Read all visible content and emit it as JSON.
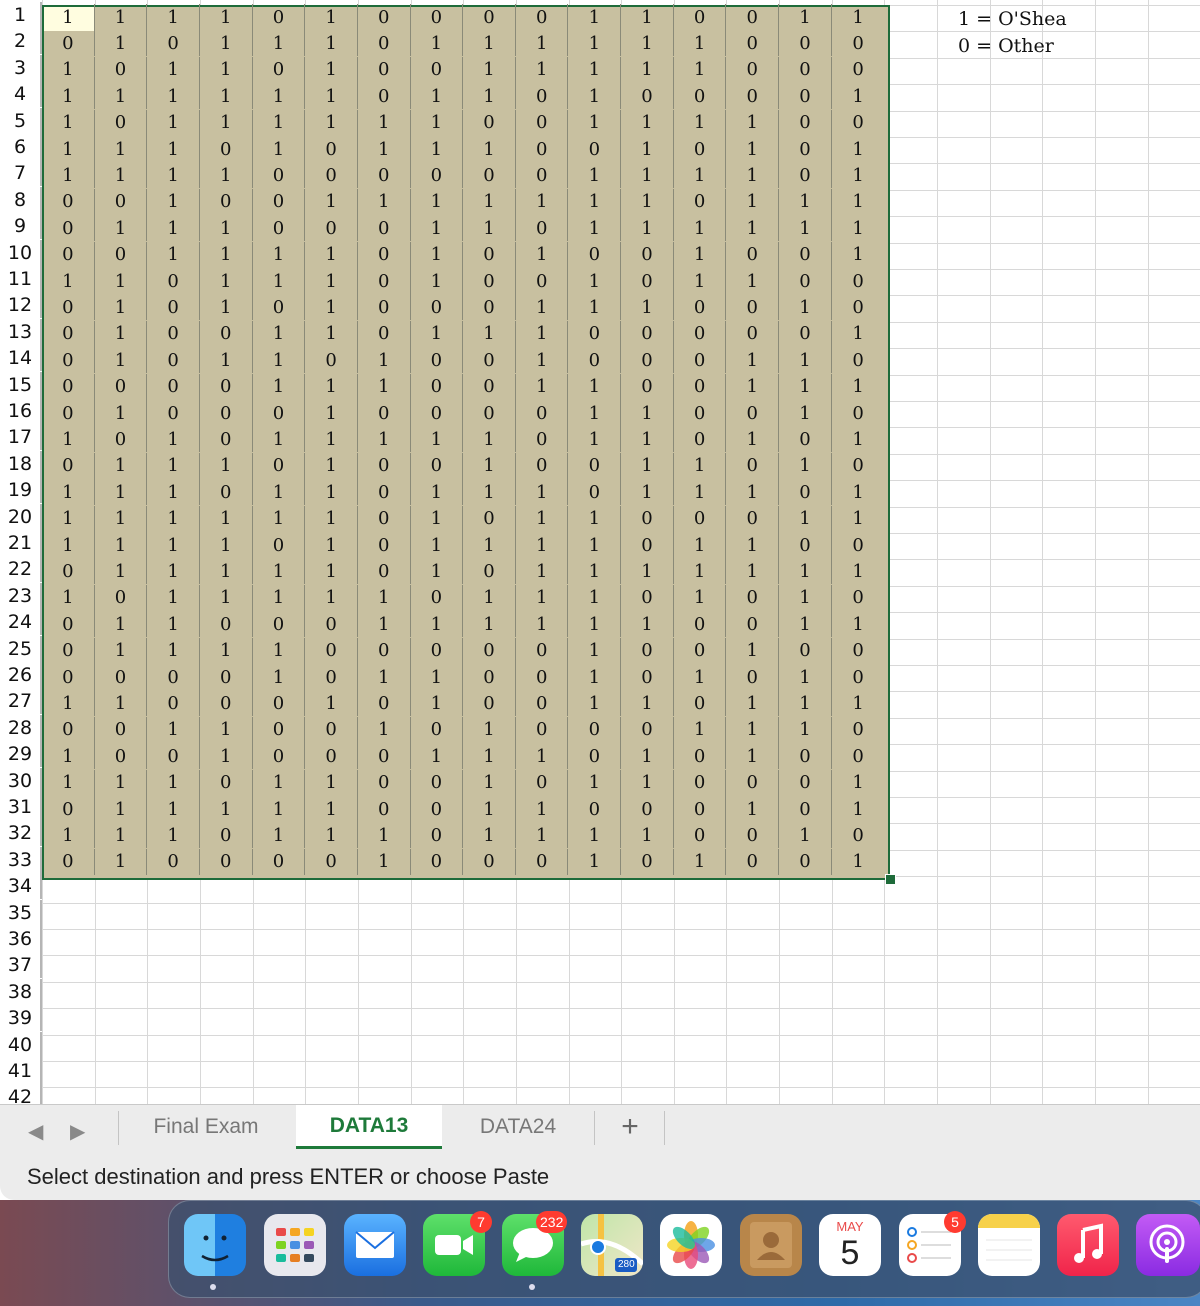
{
  "sheet": {
    "row_numbers": [
      "1",
      "2",
      "3",
      "4",
      "5",
      "6",
      "7",
      "8",
      "9",
      "10",
      "11",
      "12",
      "13",
      "14",
      "15",
      "16",
      "17",
      "18",
      "19",
      "20",
      "21",
      "22",
      "23",
      "24",
      "25",
      "26",
      "27",
      "28",
      "29",
      "30",
      "31",
      "32",
      "33",
      "34",
      "35",
      "36",
      "37",
      "38",
      "39",
      "40",
      "41",
      "42"
    ],
    "rows": [
      [
        "1",
        "1",
        "1",
        "1",
        "0",
        "1",
        "0",
        "0",
        "0",
        "0",
        "1",
        "1",
        "0",
        "0",
        "1",
        "1"
      ],
      [
        "0",
        "1",
        "0",
        "1",
        "1",
        "1",
        "0",
        "1",
        "1",
        "1",
        "1",
        "1",
        "1",
        "0",
        "0",
        "0"
      ],
      [
        "1",
        "0",
        "1",
        "1",
        "0",
        "1",
        "0",
        "0",
        "1",
        "1",
        "1",
        "1",
        "1",
        "0",
        "0",
        "0"
      ],
      [
        "1",
        "1",
        "1",
        "1",
        "1",
        "1",
        "0",
        "1",
        "1",
        "0",
        "1",
        "0",
        "0",
        "0",
        "0",
        "1"
      ],
      [
        "1",
        "0",
        "1",
        "1",
        "1",
        "1",
        "1",
        "1",
        "0",
        "0",
        "1",
        "1",
        "1",
        "1",
        "0",
        "0"
      ],
      [
        "1",
        "1",
        "1",
        "0",
        "1",
        "0",
        "1",
        "1",
        "1",
        "0",
        "0",
        "1",
        "0",
        "1",
        "0",
        "1"
      ],
      [
        "1",
        "1",
        "1",
        "1",
        "0",
        "0",
        "0",
        "0",
        "0",
        "0",
        "1",
        "1",
        "1",
        "1",
        "0",
        "1"
      ],
      [
        "0",
        "0",
        "1",
        "0",
        "0",
        "1",
        "1",
        "1",
        "1",
        "1",
        "1",
        "1",
        "0",
        "1",
        "1",
        "1"
      ],
      [
        "0",
        "1",
        "1",
        "1",
        "0",
        "0",
        "0",
        "1",
        "1",
        "0",
        "1",
        "1",
        "1",
        "1",
        "1",
        "1"
      ],
      [
        "0",
        "0",
        "1",
        "1",
        "1",
        "1",
        "0",
        "1",
        "0",
        "1",
        "0",
        "0",
        "1",
        "0",
        "0",
        "1"
      ],
      [
        "1",
        "1",
        "0",
        "1",
        "1",
        "1",
        "0",
        "1",
        "0",
        "0",
        "1",
        "0",
        "1",
        "1",
        "0",
        "0"
      ],
      [
        "0",
        "1",
        "0",
        "1",
        "0",
        "1",
        "0",
        "0",
        "0",
        "1",
        "1",
        "1",
        "0",
        "0",
        "1",
        "0"
      ],
      [
        "0",
        "1",
        "0",
        "0",
        "1",
        "1",
        "0",
        "1",
        "1",
        "1",
        "0",
        "0",
        "0",
        "0",
        "0",
        "1"
      ],
      [
        "0",
        "1",
        "0",
        "1",
        "1",
        "0",
        "1",
        "0",
        "0",
        "1",
        "0",
        "0",
        "0",
        "1",
        "1",
        "0"
      ],
      [
        "0",
        "0",
        "0",
        "0",
        "1",
        "1",
        "1",
        "0",
        "0",
        "1",
        "1",
        "0",
        "0",
        "1",
        "1",
        "1"
      ],
      [
        "0",
        "1",
        "0",
        "0",
        "0",
        "1",
        "0",
        "0",
        "0",
        "0",
        "1",
        "1",
        "0",
        "0",
        "1",
        "0"
      ],
      [
        "1",
        "0",
        "1",
        "0",
        "1",
        "1",
        "1",
        "1",
        "1",
        "0",
        "1",
        "1",
        "0",
        "1",
        "0",
        "1"
      ],
      [
        "0",
        "1",
        "1",
        "1",
        "0",
        "1",
        "0",
        "0",
        "1",
        "0",
        "0",
        "1",
        "1",
        "0",
        "1",
        "0"
      ],
      [
        "1",
        "1",
        "1",
        "0",
        "1",
        "1",
        "0",
        "1",
        "1",
        "1",
        "0",
        "1",
        "1",
        "1",
        "0",
        "1"
      ],
      [
        "1",
        "1",
        "1",
        "1",
        "1",
        "1",
        "0",
        "1",
        "0",
        "1",
        "1",
        "0",
        "0",
        "0",
        "1",
        "1"
      ],
      [
        "1",
        "1",
        "1",
        "1",
        "0",
        "1",
        "0",
        "1",
        "1",
        "1",
        "1",
        "0",
        "1",
        "1",
        "0",
        "0"
      ],
      [
        "0",
        "1",
        "1",
        "1",
        "1",
        "1",
        "0",
        "1",
        "0",
        "1",
        "1",
        "1",
        "1",
        "1",
        "1",
        "1"
      ],
      [
        "1",
        "0",
        "1",
        "1",
        "1",
        "1",
        "1",
        "0",
        "1",
        "1",
        "1",
        "0",
        "1",
        "0",
        "1",
        "0"
      ],
      [
        "0",
        "1",
        "1",
        "0",
        "0",
        "0",
        "1",
        "1",
        "1",
        "1",
        "1",
        "1",
        "0",
        "0",
        "1",
        "1"
      ],
      [
        "0",
        "1",
        "1",
        "1",
        "1",
        "0",
        "0",
        "0",
        "0",
        "0",
        "1",
        "0",
        "0",
        "1",
        "0",
        "0"
      ],
      [
        "0",
        "0",
        "0",
        "0",
        "1",
        "0",
        "1",
        "1",
        "0",
        "0",
        "1",
        "0",
        "1",
        "0",
        "1",
        "0"
      ],
      [
        "1",
        "1",
        "0",
        "0",
        "0",
        "1",
        "0",
        "1",
        "0",
        "0",
        "1",
        "1",
        "0",
        "1",
        "1",
        "1"
      ],
      [
        "0",
        "0",
        "1",
        "1",
        "0",
        "0",
        "1",
        "0",
        "1",
        "0",
        "0",
        "0",
        "1",
        "1",
        "1",
        "0"
      ],
      [
        "1",
        "0",
        "0",
        "1",
        "0",
        "0",
        "0",
        "1",
        "1",
        "1",
        "0",
        "1",
        "0",
        "1",
        "0",
        "0"
      ],
      [
        "1",
        "1",
        "1",
        "0",
        "1",
        "1",
        "0",
        "0",
        "1",
        "0",
        "1",
        "1",
        "0",
        "0",
        "0",
        "1"
      ],
      [
        "0",
        "1",
        "1",
        "1",
        "1",
        "1",
        "0",
        "0",
        "1",
        "1",
        "0",
        "0",
        "0",
        "1",
        "0",
        "1"
      ],
      [
        "1",
        "1",
        "1",
        "0",
        "1",
        "1",
        "1",
        "0",
        "1",
        "1",
        "1",
        "1",
        "0",
        "0",
        "1",
        "0"
      ],
      [
        "0",
        "1",
        "0",
        "0",
        "0",
        "0",
        "1",
        "0",
        "0",
        "0",
        "1",
        "0",
        "1",
        "0",
        "0",
        "1"
      ]
    ],
    "legend": {
      "line1": "1 = O'Shea",
      "line2": "0 = Other"
    },
    "selection_color": "#c8c0a0",
    "selection_border_color": "#1e6b3a"
  },
  "tabbar": {
    "tabs": [
      {
        "label": "Final Exam",
        "active": false
      },
      {
        "label": "DATA13",
        "active": true
      },
      {
        "label": "DATA24",
        "active": false
      }
    ],
    "add_sheet_label": "+",
    "prev_icon": "prev-sheet-icon",
    "next_icon": "next-sheet-icon",
    "accent": "#1e7a3a"
  },
  "statusbar": {
    "message": "Select destination and press ENTER or choose Paste"
  },
  "dock": {
    "apps": [
      {
        "name": "finder-icon"
      },
      {
        "name": "launchpad-icon"
      },
      {
        "name": "mail-icon"
      },
      {
        "name": "facetime-icon",
        "badge": "7"
      },
      {
        "name": "messages-icon",
        "badge": "232"
      },
      {
        "name": "maps-icon",
        "sign": "280"
      },
      {
        "name": "photos-icon"
      },
      {
        "name": "contacts-icon"
      },
      {
        "name": "calendar-icon",
        "month": "MAY",
        "day": "5"
      },
      {
        "name": "reminders-icon",
        "badge": "5"
      },
      {
        "name": "notes-icon"
      },
      {
        "name": "music-icon"
      },
      {
        "name": "podcasts-icon"
      }
    ]
  }
}
